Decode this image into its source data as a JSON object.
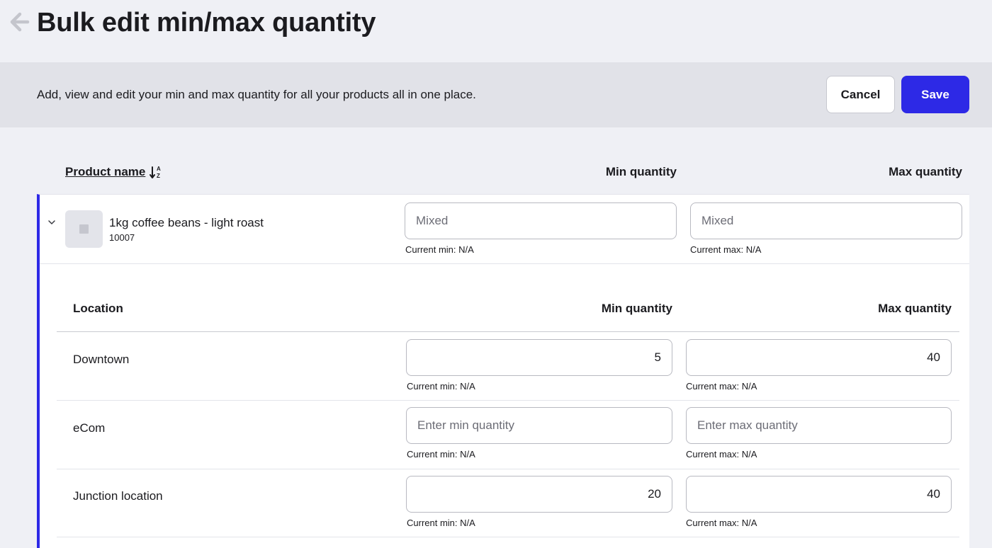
{
  "header": {
    "title": "Bulk edit min/max quantity",
    "back_icon": "arrow-left-icon"
  },
  "banner": {
    "description": "Add, view and edit your min and max quantity for all your products all in one place.",
    "cancel_label": "Cancel",
    "save_label": "Save"
  },
  "table": {
    "col_product": "Product name",
    "col_min": "Min quantity",
    "col_max": "Max quantity",
    "sort_icon": "sort-alpha-down-icon"
  },
  "product": {
    "name": "1kg coffee beans - light roast",
    "sku": "10007",
    "min_placeholder": "Mixed",
    "max_placeholder": "Mixed",
    "current_min": "Current min: N/A",
    "current_max": "Current max: N/A",
    "expand_icon": "chevron-down-icon",
    "thumbnail_icon": "image-placeholder-icon"
  },
  "locations": {
    "col_location": "Location",
    "col_min": "Min quantity",
    "col_max": "Max quantity",
    "rows": [
      {
        "name": "Downtown",
        "min_value": "5",
        "max_value": "40",
        "min_placeholder": "",
        "max_placeholder": "",
        "current_min": "Current min: N/A",
        "current_max": "Current max: N/A"
      },
      {
        "name": "eCom",
        "min_value": "",
        "max_value": "",
        "min_placeholder": "Enter min quantity",
        "max_placeholder": "Enter max quantity",
        "current_min": "Current min: N/A",
        "current_max": "Current max: N/A"
      },
      {
        "name": "Junction location",
        "min_value": "20",
        "max_value": "40",
        "min_placeholder": "",
        "max_placeholder": "",
        "current_min": "Current min: N/A",
        "current_max": "Current max: N/A"
      }
    ]
  },
  "colors": {
    "accent": "#2d29e6",
    "background": "#eff0f5",
    "banner": "#e1e2e8"
  }
}
